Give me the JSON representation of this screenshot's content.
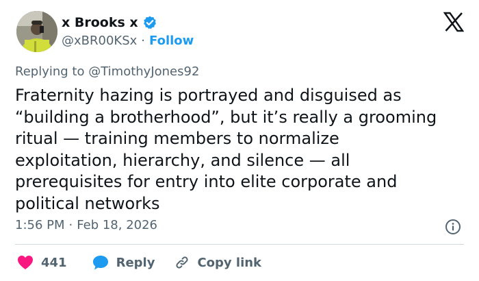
{
  "author": {
    "display_name": "x Brooks x",
    "handle": "@xBR00KSx",
    "separator": "·",
    "follow_label": "Follow",
    "verified": true
  },
  "reply_context": {
    "prefix": "Replying to",
    "mention": "@TimothyJones92"
  },
  "tweet": {
    "text": "Fraternity hazing is portrayed and disguised as\n“building a brotherhood”, but it’s really a grooming\nritual — training members to normalize\nexploitation, hierarchy, and silence — all\nprerequisites for entry into elite corporate and\npolitical networks",
    "time": "1:56 PM",
    "separator": "·",
    "date": "Feb 18, 2026"
  },
  "actions": {
    "like_count": "441",
    "reply_label": "Reply",
    "copy_link_label": "Copy link"
  },
  "icons": {
    "brand": "x-logo-icon",
    "verified": "verified-badge-icon",
    "info": "info-icon",
    "like": "heart-icon",
    "reply": "speech-bubble-icon",
    "copy": "link-icon"
  },
  "colors": {
    "accent": "#1d9bf0",
    "like": "#f91880",
    "text": "#0f1419",
    "secondary": "#536471",
    "divider": "#cfd9de"
  }
}
